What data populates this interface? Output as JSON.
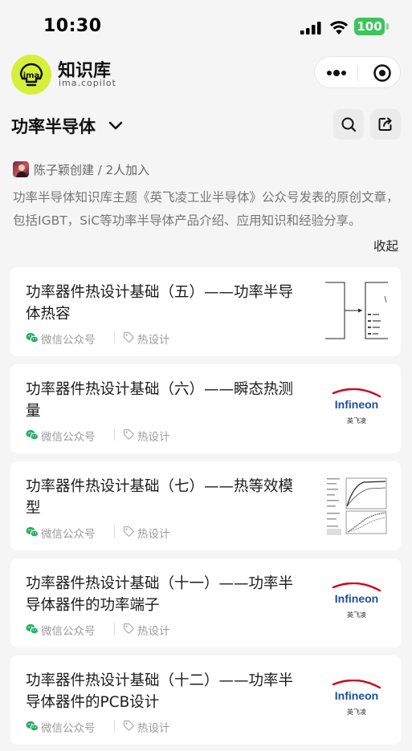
{
  "status_bar": {
    "time": "10:30",
    "battery": "100"
  },
  "header": {
    "brand_title": "知识库",
    "brand_sub": "ima.copilot",
    "logo_text": "ima"
  },
  "kb": {
    "title": "功率半导体",
    "creator": "陈子颖创建 / 2人加入",
    "description": "功率半导体知识库主题《英飞凌工业半导体》公众号发表的原创文章，包括IGBT，SiC等功率半导体产品介绍、应用知识和经验分享。",
    "collapse_label": "收起"
  },
  "articles": [
    {
      "title": "功率器件热设计基础（五）——功率半导体热容",
      "source": "微信公众号",
      "tag": "热设计",
      "thumb": "diagram"
    },
    {
      "title": "功率器件热设计基础（六）——瞬态热测量",
      "source": "微信公众号",
      "tag": "热设计",
      "thumb": "infineon"
    },
    {
      "title": "功率器件热设计基础（七）——热等效模型",
      "source": "微信公众号",
      "tag": "热设计",
      "thumb": "plot"
    },
    {
      "title": "功率器件热设计基础（十一）——功率半导体器件的功率端子",
      "source": "微信公众号",
      "tag": "热设计",
      "thumb": "infineon"
    },
    {
      "title": "功率器件热设计基础（十二）——功率半导体器件的PCB设计",
      "source": "微信公众号",
      "tag": "热设计",
      "thumb": "infineon"
    }
  ],
  "icons": {
    "more": "more-dots-icon",
    "record": "record-icon",
    "search": "search-icon",
    "share": "share-icon",
    "chevron": "chevron-down-icon",
    "wechat": "wechat-icon",
    "tag": "tag-icon"
  },
  "brand_logo_text": "Infineon",
  "brand_logo_cn": "英飞凌",
  "colors": {
    "logo_bg": "#d6ef3b",
    "battery": "#3cc55a",
    "wechat": "#2aae67",
    "infineon_red": "#d0021b",
    "infineon_blue": "#1d4fa0"
  }
}
